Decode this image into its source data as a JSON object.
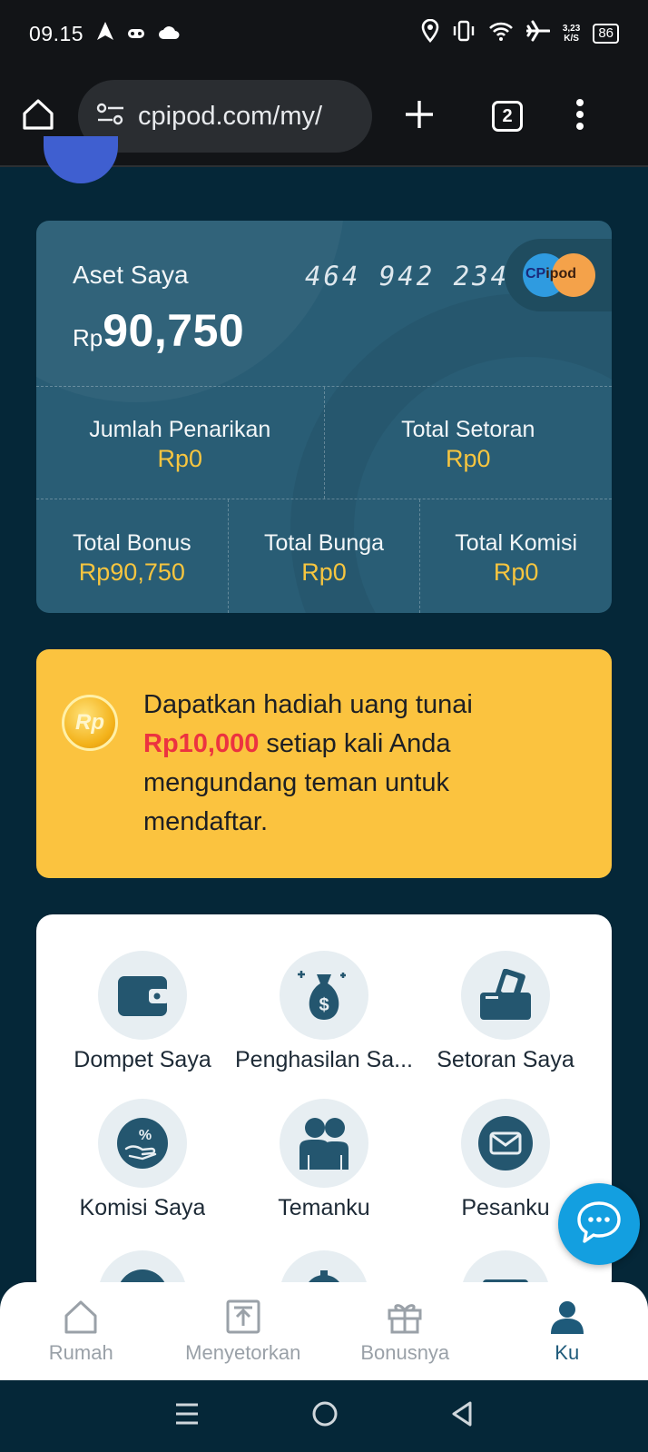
{
  "status_bar": {
    "time": "09.15",
    "net_speed_value": "3,23",
    "net_speed_unit": "K/S",
    "battery": "86"
  },
  "browser": {
    "url": "cpipod.com/my/",
    "tab_count": "2"
  },
  "asset_card": {
    "label": "Aset Saya",
    "currency": "Rp",
    "amount": "90,750",
    "account_number": "464 942 234",
    "logo_cp": "CP",
    "logo_ipod": "ipod",
    "stats_row1": [
      {
        "label": "Jumlah Penarikan",
        "value": "Rp0"
      },
      {
        "label": "Total Setoran",
        "value": "Rp0"
      }
    ],
    "stats_row2": [
      {
        "label": "Total Bonus",
        "value": "Rp90,750"
      },
      {
        "label": "Total Bunga",
        "value": "Rp0"
      },
      {
        "label": "Total Komisi",
        "value": "Rp0"
      }
    ]
  },
  "promo": {
    "coin_text": "Rp",
    "text_before": "Dapatkan hadiah uang tunai",
    "highlight": "Rp10,000",
    "text_after": "setiap kali Anda mengundang teman untuk mendaftar."
  },
  "menu": {
    "items": [
      {
        "label": "Dompet Saya",
        "icon": "wallet-icon"
      },
      {
        "label": "Penghasilan Sa...",
        "icon": "money-bag-icon"
      },
      {
        "label": "Setoran Saya",
        "icon": "deposit-icon"
      },
      {
        "label": "Komisi Saya",
        "icon": "commission-icon"
      },
      {
        "label": "Temanku",
        "icon": "friends-icon"
      },
      {
        "label": "Pesanku",
        "icon": "mail-icon"
      }
    ]
  },
  "bottom_nav": {
    "items": [
      {
        "label": "Rumah",
        "icon": "home-icon"
      },
      {
        "label": "Menyetorkan",
        "icon": "upload-icon"
      },
      {
        "label": "Bonusnya",
        "icon": "gift-icon"
      },
      {
        "label": "Ku",
        "icon": "user-icon"
      }
    ],
    "active": "Ku"
  },
  "colors": {
    "page_bg": "#052738",
    "card_bg": "#295d75",
    "accent_yellow": "#f7c53f",
    "promo_bg": "#fbc33f",
    "highlight_red": "#ec3340",
    "fab_blue": "#139fe0",
    "icon_teal": "#24566f"
  }
}
